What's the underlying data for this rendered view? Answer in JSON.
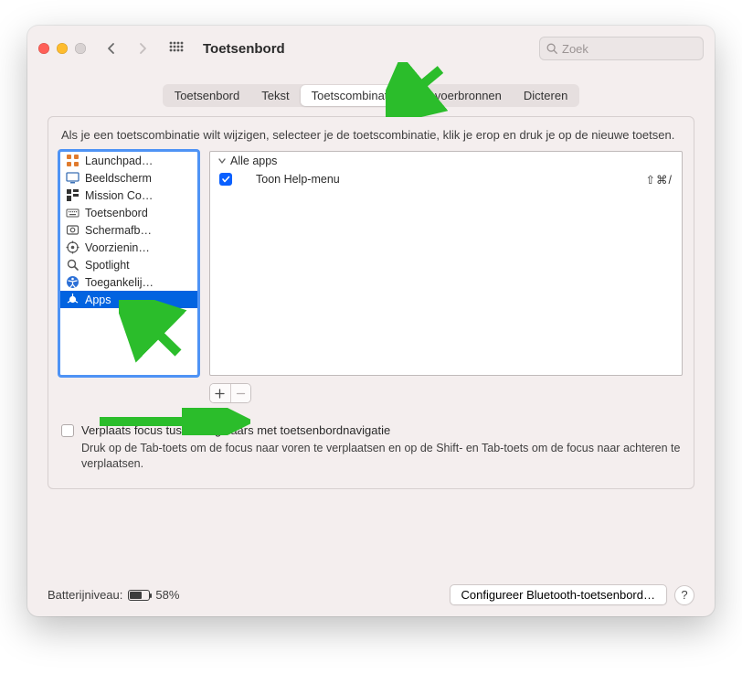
{
  "window": {
    "title": "Toetsenbord"
  },
  "search": {
    "placeholder": "Zoek"
  },
  "tabs": [
    {
      "label": "Toetsenbord",
      "active": false
    },
    {
      "label": "Tekst",
      "active": false
    },
    {
      "label": "Toetscombinaties",
      "active": true
    },
    {
      "label": "Invoerbronnen",
      "active": false
    },
    {
      "label": "Dicteren",
      "active": false
    }
  ],
  "instruction": "Als je een toetscombinatie wilt wijzigen, selecteer je de toetscombinatie, klik je erop en druk je op de nieuwe toetsen.",
  "categories": [
    {
      "label": "Launchpad…",
      "icon": "launchpad",
      "selected": false
    },
    {
      "label": "Beeldscherm",
      "icon": "display",
      "selected": false
    },
    {
      "label": "Mission Co…",
      "icon": "mission",
      "selected": false
    },
    {
      "label": "Toetsenbord",
      "icon": "keyboard",
      "selected": false
    },
    {
      "label": "Schermafb…",
      "icon": "screenshot",
      "selected": false
    },
    {
      "label": "Voorzienin…",
      "icon": "services",
      "selected": false
    },
    {
      "label": "Spotlight",
      "icon": "spotlight",
      "selected": false
    },
    {
      "label": "Toegankelij…",
      "icon": "accessibility",
      "selected": false
    },
    {
      "label": "Apps",
      "icon": "apps",
      "selected": true
    }
  ],
  "shortcuts": {
    "group_label": "Alle apps",
    "items": [
      {
        "enabled": true,
        "label": "Toon Help-menu",
        "keys": "⇧⌘/"
      }
    ]
  },
  "buttons": {
    "add": "＋",
    "remove": "－"
  },
  "focus_checkbox_label": "Verplaats focus tussen regelaars met toetsenbordnavigatie",
  "focus_hint": "Druk op de Tab-toets om de focus naar voren te verplaatsen en op de Shift- en Tab-toets om de focus naar achteren te verplaatsen.",
  "footer": {
    "battery_label": "Batterijniveau:",
    "battery_pct": "58%",
    "bluetooth_button": "Configureer Bluetooth-toetsenbord…",
    "help": "?"
  }
}
